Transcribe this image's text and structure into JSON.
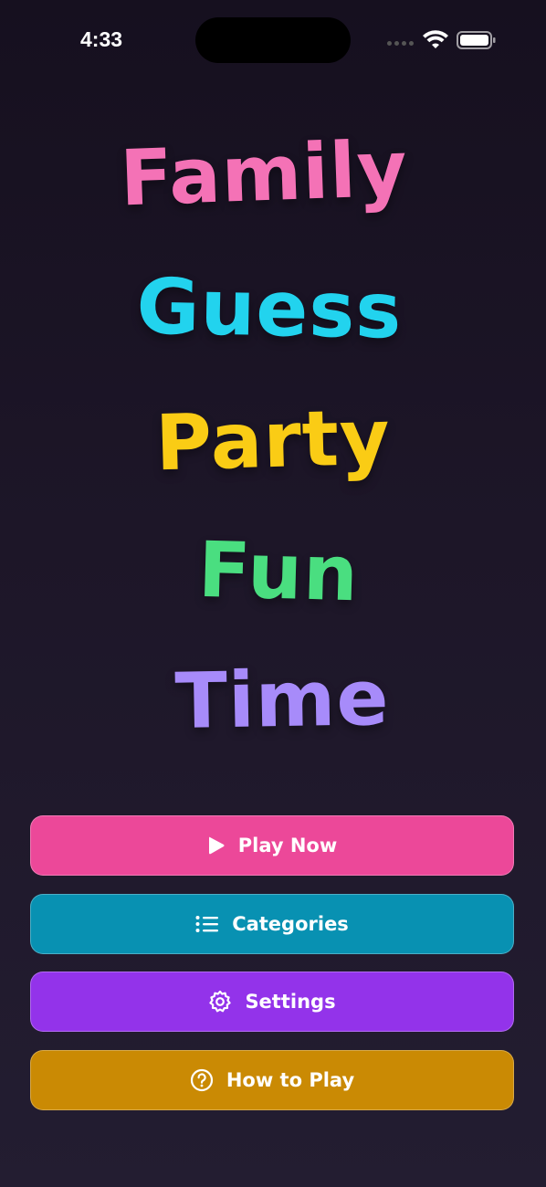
{
  "status_bar": {
    "time": "4:33",
    "icons": [
      "signal-dots-icon",
      "wifi-icon",
      "battery-icon"
    ]
  },
  "title_words": [
    {
      "text": "Family",
      "color": "#f472b6"
    },
    {
      "text": "Guess",
      "color": "#22d3ee"
    },
    {
      "text": "Party",
      "color": "#facc15"
    },
    {
      "text": "Fun",
      "color": "#4ade80"
    },
    {
      "text": "Time",
      "color": "#a78bfa"
    }
  ],
  "menu": {
    "play": {
      "label": "Play Now",
      "icon": "play-icon",
      "color": "#ec4899"
    },
    "categories": {
      "label": "Categories",
      "icon": "list-icon",
      "color": "#0891b2"
    },
    "settings": {
      "label": "Settings",
      "icon": "gear-icon",
      "color": "#9333ea"
    },
    "how_to_play": {
      "label": "How to Play",
      "icon": "question-circle-icon",
      "color": "#ca8a04"
    }
  }
}
